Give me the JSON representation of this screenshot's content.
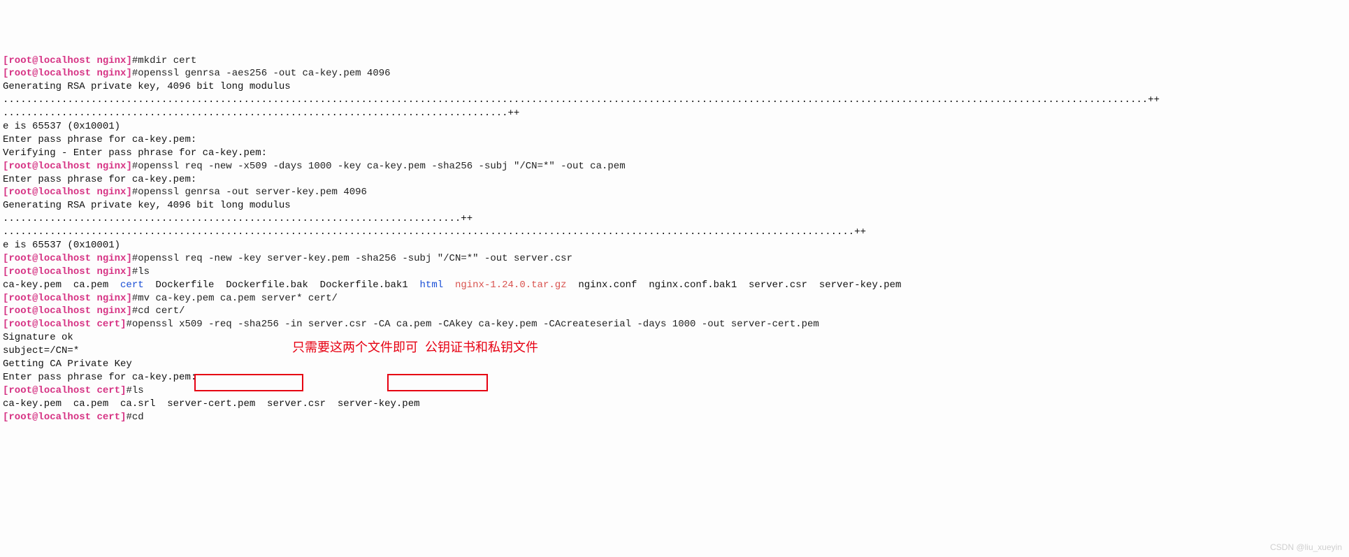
{
  "prompts": {
    "nginx": {
      "user": "root",
      "host": "localhost",
      "path": "nginx",
      "hash": "#"
    },
    "cert": {
      "user": "root",
      "host": "localhost",
      "path": "cert",
      "hash": "#"
    }
  },
  "lines": {
    "cmd1": "mkdir cert",
    "cmd2": "openssl genrsa -aes256 -out ca-key.pem 4096",
    "out2a": "Generating RSA private key, 4096 bit long modulus",
    "out2b": "...................................................................................................................................................................................................++",
    "out2c": "......................................................................................++",
    "out2d": "e is 65537 (0x10001)",
    "out2e": "Enter pass phrase for ca-key.pem:",
    "out2f": "Verifying - Enter pass phrase for ca-key.pem:",
    "cmd3": "openssl req -new -x509 -days 1000 -key ca-key.pem -sha256 -subj \"/CN=*\" -out ca.pem",
    "out3a": "Enter pass phrase for ca-key.pem:",
    "cmd4": "openssl genrsa -out server-key.pem 4096",
    "out4a": "Generating RSA private key, 4096 bit long modulus",
    "out4b": "..............................................................................++",
    "out4c": ".................................................................................................................................................++",
    "out4d": "e is 65537 (0x10001)",
    "cmd5": "openssl req -new -key server-key.pem -sha256 -subj \"/CN=*\" -out server.csr",
    "cmd6": "ls",
    "ls1": {
      "a": "ca-key.pem  ca.pem  ",
      "cert": "cert",
      "b": "  Dockerfile  Dockerfile.bak  Dockerfile.bak1  ",
      "html": "html",
      "c": "  ",
      "arc": "nginx-1.24.0.tar.gz",
      "d": "  nginx.conf  nginx.conf.bak1  server.csr  server-key.pem"
    },
    "cmd7": "mv ca-key.pem ca.pem server* cert/",
    "cmd8": "cd cert/",
    "cmd9": "openssl x509 -req -sha256 -in server.csr -CA ca.pem -CAkey ca-key.pem -CAcreateserial -days 1000 -out server-cert.pem",
    "out9a": "Signature ok",
    "out9b": "subject=/CN=*",
    "out9c": "Getting CA Private Key",
    "out9d": "Enter pass phrase for ca-key.pem:",
    "cmd10": "ls",
    "ls2": "ca-key.pem  ca.pem  ca.srl  server-cert.pem  server.csr  server-key.pem",
    "cmd11": "cd"
  },
  "annotation": "只需要这两个文件即可  公钥证书和私钥文件",
  "watermark": "CSDN @liu_xueyin"
}
